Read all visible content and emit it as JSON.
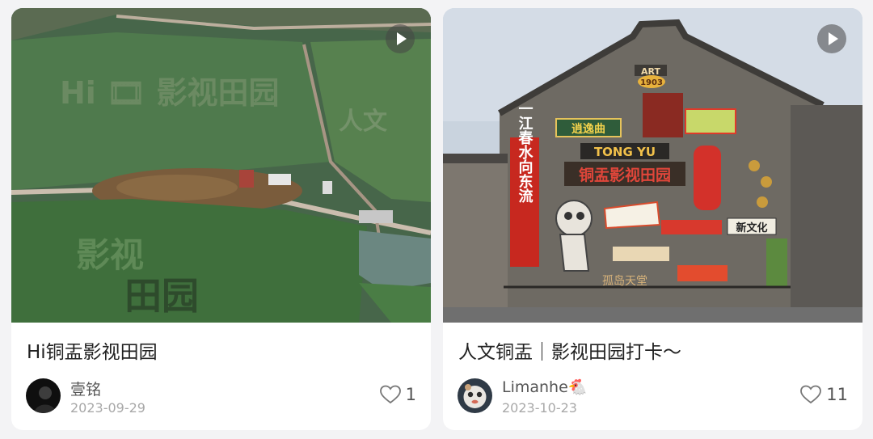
{
  "cards": [
    {
      "title": "Hi铜盂影视田园",
      "author": "壹铭",
      "date": "2023-09-29",
      "likes": "1",
      "image": {
        "field_text_top": "Hi 🎞 影视田园",
        "field_text_right": "人文",
        "field_text_bottom_1": "影视",
        "field_text_bottom_2": "田园"
      }
    },
    {
      "title": "人文铜盂｜影视田园打卡～",
      "author": "Limanhe🐔",
      "date": "2023-10-23",
      "likes": "11",
      "image": {
        "sign_art": "ART",
        "sign_year": "1903",
        "sign_tongyu": "TONG YU",
        "sign_main": "铜盂影视田园",
        "sign_top": "逍逸曲",
        "sign_vertical": "一江春水向东流",
        "sign_new": "新文化",
        "sign_corner": "孤岛天堂"
      }
    }
  ],
  "colors": {
    "card_bg": "#ffffff",
    "page_bg": "#f3f3f5",
    "title": "#222222",
    "meta": "#a8a8a8"
  },
  "icons": {
    "play": "play-icon",
    "like": "heart-outline-icon"
  }
}
